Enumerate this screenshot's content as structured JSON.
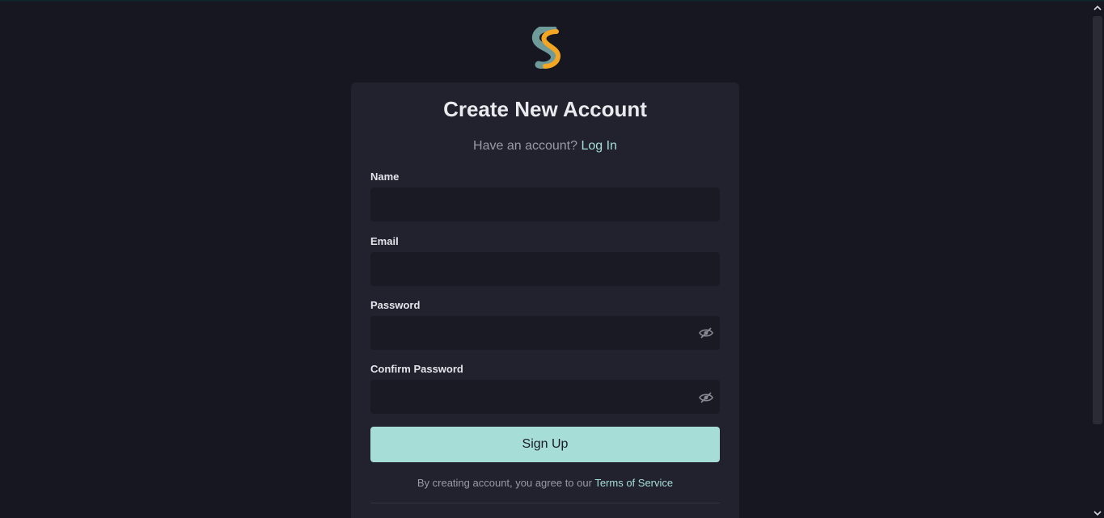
{
  "brand": {
    "logo_icon": "s-logo-icon",
    "colors": {
      "background": "#171722",
      "card": "#22222f",
      "input": "#1a1a24",
      "accent": "#a6ded7",
      "logo_orange": "#f4a623",
      "logo_teal": "#6e9a9a"
    }
  },
  "card": {
    "title": "Create New Account",
    "subtitle_text": "Have an account?",
    "login_link": "Log In"
  },
  "form": {
    "name": {
      "label": "Name",
      "value": "",
      "placeholder": ""
    },
    "email": {
      "label": "Email",
      "value": "",
      "placeholder": ""
    },
    "password": {
      "label": "Password",
      "value": "",
      "placeholder": "",
      "toggle_icon": "eye-off-icon"
    },
    "confirm_password": {
      "label": "Confirm Password",
      "value": "",
      "placeholder": "",
      "toggle_icon": "eye-off-icon"
    },
    "submit_label": "Sign Up"
  },
  "terms": {
    "text": "By creating account, you agree to our",
    "link": "Terms of Service"
  }
}
